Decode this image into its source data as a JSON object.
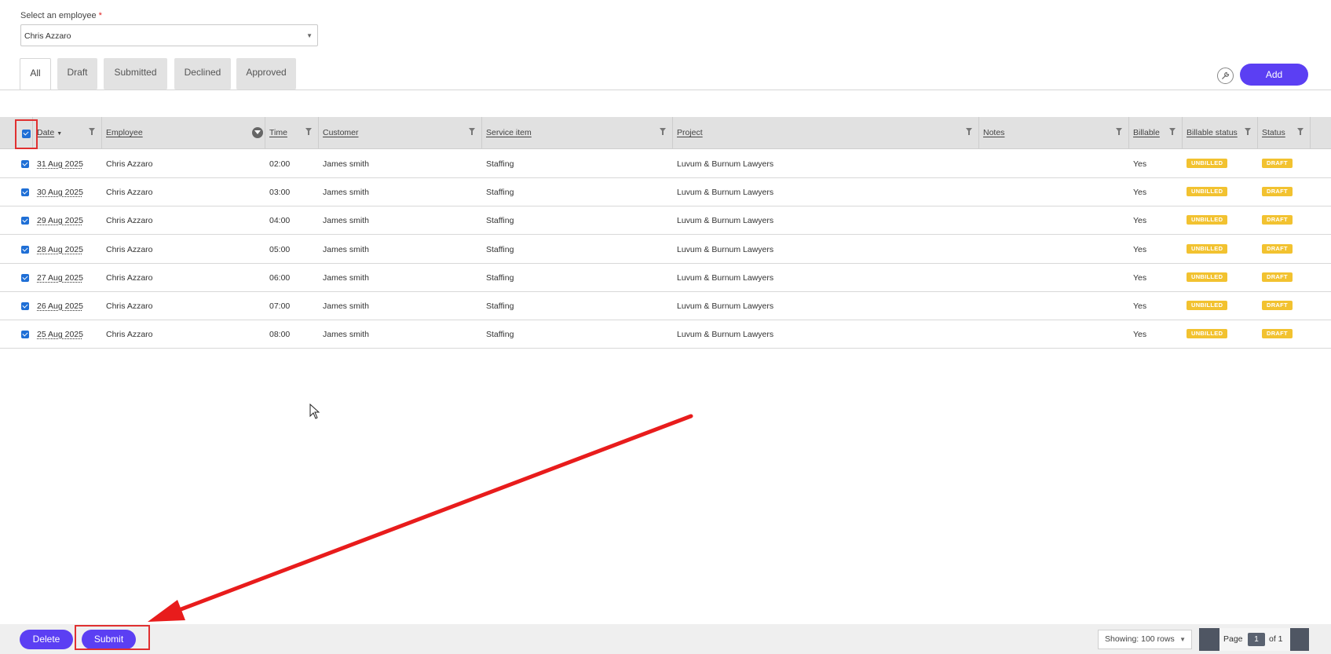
{
  "employee_select": {
    "label": "Select an employee",
    "required_mark": "*",
    "value": "Chris Azzaro"
  },
  "tabs": [
    {
      "label": "All",
      "active": true
    },
    {
      "label": "Draft",
      "active": false
    },
    {
      "label": "Submitted",
      "active": false
    },
    {
      "label": "Declined",
      "active": false
    },
    {
      "label": "Approved",
      "active": false
    }
  ],
  "toolbar": {
    "add_label": "Add",
    "tools_icon": "wrench-icon"
  },
  "table": {
    "columns": [
      "Date",
      "Employee",
      "Time",
      "Customer",
      "Service item",
      "Project",
      "Notes",
      "Billable",
      "Billable status",
      "Status"
    ],
    "rows": [
      {
        "date": "31 Aug 2025",
        "employee": "Chris Azzaro",
        "time": "02:00",
        "customer": "James smith",
        "service": "Staffing",
        "project": "Luvum & Burnum Lawyers",
        "notes": "",
        "billable": "Yes",
        "billable_status": "UNBILLED",
        "status": "DRAFT"
      },
      {
        "date": "30 Aug 2025",
        "employee": "Chris Azzaro",
        "time": "03:00",
        "customer": "James smith",
        "service": "Staffing",
        "project": "Luvum & Burnum Lawyers",
        "notes": "",
        "billable": "Yes",
        "billable_status": "UNBILLED",
        "status": "DRAFT"
      },
      {
        "date": "29 Aug 2025",
        "employee": "Chris Azzaro",
        "time": "04:00",
        "customer": "James smith",
        "service": "Staffing",
        "project": "Luvum & Burnum Lawyers",
        "notes": "",
        "billable": "Yes",
        "billable_status": "UNBILLED",
        "status": "DRAFT"
      },
      {
        "date": "28 Aug 2025",
        "employee": "Chris Azzaro",
        "time": "05:00",
        "customer": "James smith",
        "service": "Staffing",
        "project": "Luvum & Burnum Lawyers",
        "notes": "",
        "billable": "Yes",
        "billable_status": "UNBILLED",
        "status": "DRAFT"
      },
      {
        "date": "27 Aug 2025",
        "employee": "Chris Azzaro",
        "time": "06:00",
        "customer": "James smith",
        "service": "Staffing",
        "project": "Luvum & Burnum Lawyers",
        "notes": "",
        "billable": "Yes",
        "billable_status": "UNBILLED",
        "status": "DRAFT"
      },
      {
        "date": "26 Aug 2025",
        "employee": "Chris Azzaro",
        "time": "07:00",
        "customer": "James smith",
        "service": "Staffing",
        "project": "Luvum & Burnum Lawyers",
        "notes": "",
        "billable": "Yes",
        "billable_status": "UNBILLED",
        "status": "DRAFT"
      },
      {
        "date": "25 Aug 2025",
        "employee": "Chris Azzaro",
        "time": "08:00",
        "customer": "James smith",
        "service": "Staffing",
        "project": "Luvum & Burnum Lawyers",
        "notes": "",
        "billable": "Yes",
        "billable_status": "UNBILLED",
        "status": "DRAFT"
      }
    ]
  },
  "footer": {
    "delete_label": "Delete",
    "submit_label": "Submit",
    "showing_label": "Showing: 100 rows",
    "page_label": "Page",
    "page_number": "1",
    "page_of": "of 1"
  },
  "colors": {
    "accent": "#5b3ff3",
    "badge": "#f2c230",
    "annotation": "#e03030",
    "checkbox": "#1f6fd6"
  }
}
